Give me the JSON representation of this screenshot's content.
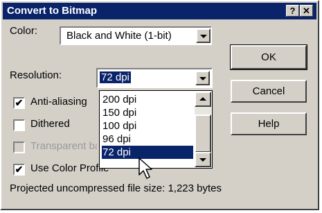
{
  "window": {
    "title": "Convert to Bitmap",
    "help_button": "?",
    "close_button": "✕"
  },
  "color": {
    "label": "Color:",
    "value": "Black and White (1-bit)"
  },
  "resolution": {
    "label": "Resolution:",
    "value": "72 dpi",
    "options": [
      "200 dpi",
      "150 dpi",
      "100 dpi",
      "96 dpi",
      "72 dpi"
    ],
    "selected": "72 dpi"
  },
  "options": {
    "anti_alias": {
      "label": "Anti-aliasing",
      "checked": true
    },
    "dithered": {
      "label": "Dithered",
      "checked": false
    },
    "transparent": {
      "label": "Transparent background",
      "checked": false,
      "disabled": true
    },
    "color_profile": {
      "label": "Use Color Profile",
      "checked": true
    }
  },
  "buttons": {
    "ok": "OK",
    "cancel": "Cancel",
    "help": "Help"
  },
  "file_size": "Projected uncompressed file size: 1,223 bytes",
  "colors": {
    "face": "#d4d0c8",
    "title_bar": "#0a246a",
    "selection": "#0a246a"
  }
}
